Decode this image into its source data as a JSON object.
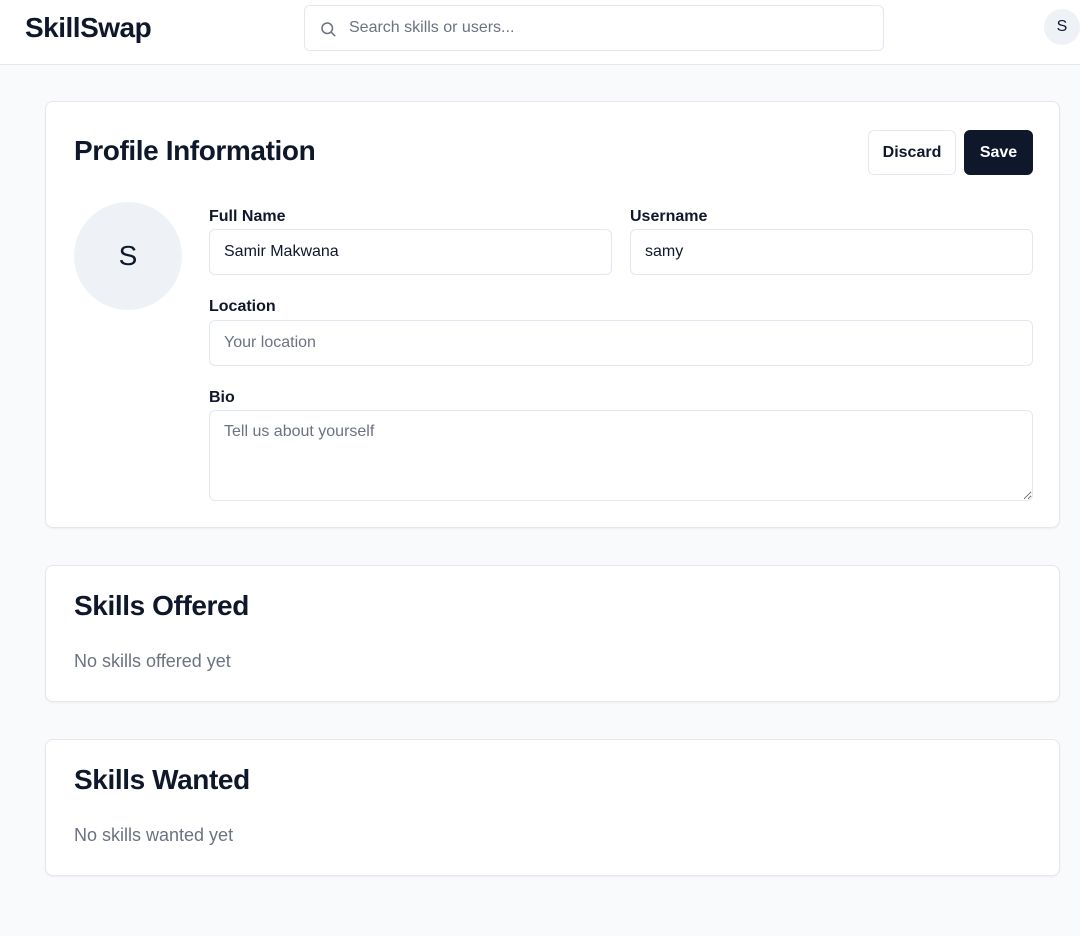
{
  "header": {
    "logo": "SkillSwap",
    "search_placeholder": "Search skills or users...",
    "avatar_initial": "S"
  },
  "profile": {
    "title": "Profile Information",
    "discard_label": "Discard",
    "save_label": "Save",
    "avatar_initial": "S",
    "full_name_label": "Full Name",
    "full_name_value": "Samir Makwana",
    "username_label": "Username",
    "username_value": "samy",
    "location_label": "Location",
    "location_placeholder": "Your location",
    "bio_label": "Bio",
    "bio_placeholder": "Tell us about yourself"
  },
  "skills_offered": {
    "title": "Skills Offered",
    "empty_text": "No skills offered yet"
  },
  "skills_wanted": {
    "title": "Skills Wanted",
    "empty_text": "No skills wanted yet"
  },
  "colors": {
    "primary": "#0f172a",
    "background": "#f8fafc",
    "muted_text": "#6b7280",
    "border": "#e2e8f0",
    "avatar_bg": "#eef2f7"
  }
}
